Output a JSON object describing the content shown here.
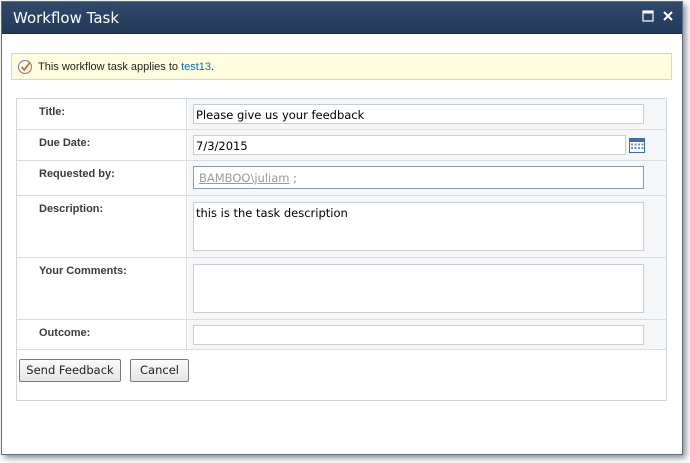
{
  "dialog": {
    "title": "Workflow Task",
    "maximize_icon": "maximize-icon",
    "close_icon": "close-icon"
  },
  "notice": {
    "icon": "workflow-task-icon",
    "text": "This workflow task applies to ",
    "link": "test13",
    "suffix": "."
  },
  "form": {
    "title": {
      "label": "Title:",
      "value": "Please give us your feedback"
    },
    "due_date": {
      "label": "Due Date:",
      "value": "7/3/2015",
      "icon": "calendar-icon"
    },
    "requested_by": {
      "label": "Requested by:",
      "person": "BAMBOO\\juliam",
      "separator": " ;"
    },
    "description": {
      "label": "Description:",
      "value": "this is the task description"
    },
    "comments": {
      "label": "Your Comments:",
      "value": ""
    },
    "outcome": {
      "label": "Outcome:",
      "value": ""
    }
  },
  "buttons": {
    "send": "Send Feedback",
    "cancel": "Cancel"
  },
  "colors": {
    "titlebar": "#2a4262",
    "notice_bg": "#fffde0",
    "link": "#0072bc",
    "field_bg": "#f5f6f7"
  }
}
